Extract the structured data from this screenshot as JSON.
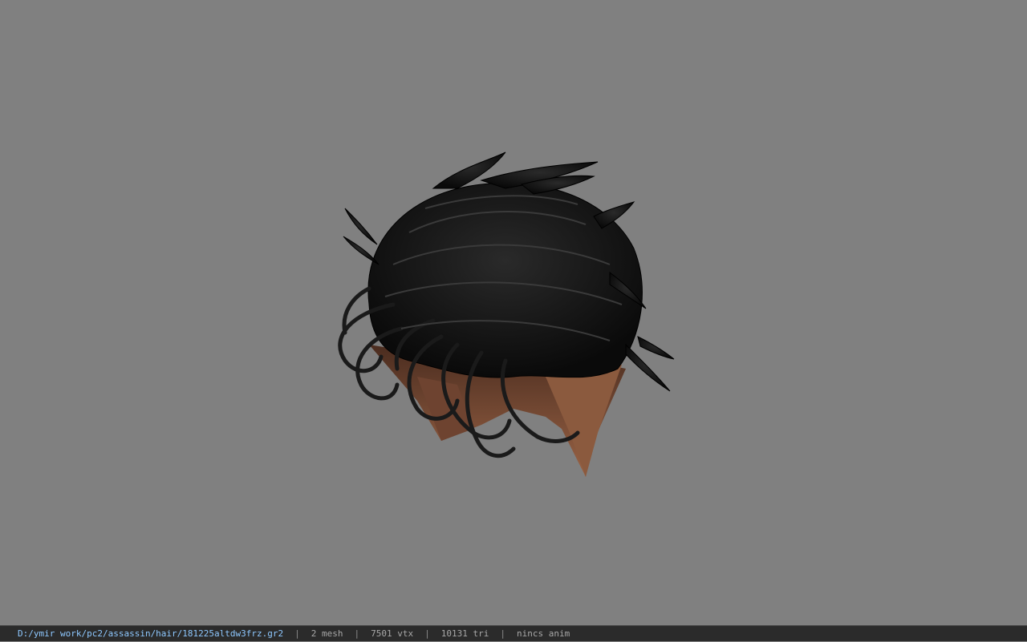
{
  "status_bar": {
    "file_path": "D:/ymir work/pc2/assassin/hair/181225altdw3frz.gr2",
    "separator": "|",
    "mesh_count": "2 mesh",
    "vertex_count": "7501 vtx",
    "triangle_count": "10131 tri",
    "anim_status": "nincs anim"
  },
  "colors": {
    "viewport_bg": "#808080",
    "hair": "#151515",
    "skin": "#7a4a33",
    "path_text": "#8ec8ff"
  }
}
